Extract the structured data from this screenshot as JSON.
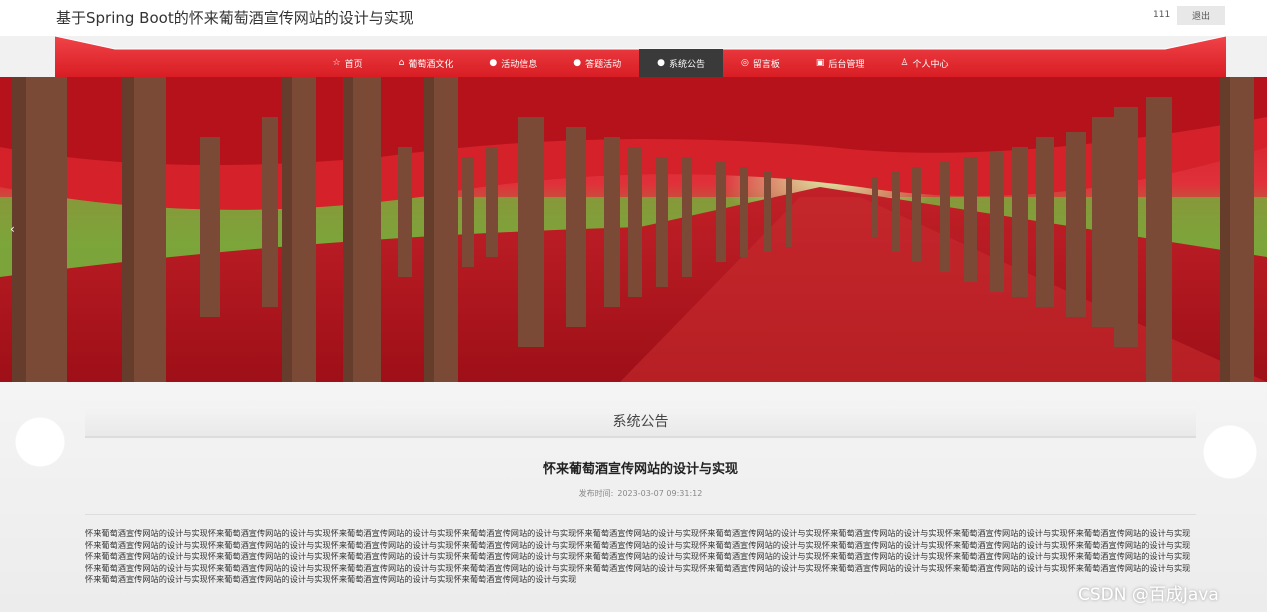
{
  "header": {
    "site_title": "基于Spring Boot的怀来葡萄酒宣传网站的设计与实现",
    "username": "111",
    "logout_label": "退出"
  },
  "nav": {
    "items": [
      {
        "label": "首页",
        "icon": "star-icon",
        "glyph": "☆"
      },
      {
        "label": "葡萄酒文化",
        "icon": "home-icon",
        "glyph": "⌂"
      },
      {
        "label": "活动信息",
        "icon": "info-icon",
        "glyph": "●"
      },
      {
        "label": "答题活动",
        "icon": "info-icon",
        "glyph": "●"
      },
      {
        "label": "系统公告",
        "icon": "info-icon",
        "glyph": "●",
        "active": true
      },
      {
        "label": "留言板",
        "icon": "message-icon",
        "glyph": "◎"
      },
      {
        "label": "后台管理",
        "icon": "admin-icon",
        "glyph": "▣"
      },
      {
        "label": "个人中心",
        "icon": "user-icon",
        "glyph": "♙"
      }
    ],
    "active_color": "#3a3a3a",
    "bar_color": "#e8262b"
  },
  "banner": {
    "description_icon": "red-maple-avenue-image",
    "prev_label": "‹"
  },
  "notice": {
    "section_title": "系统公告",
    "article_title": "怀来葡萄酒宣传网站的设计与实现",
    "publish_label": "发布时间:",
    "publish_time": "2023-03-07 09:31:12",
    "body": "怀来葡萄酒宣传网站的设计与实现怀来葡萄酒宣传网站的设计与实现怀来葡萄酒宣传网站的设计与实现怀来葡萄酒宣传网站的设计与实现怀来葡萄酒宣传网站的设计与实现怀来葡萄酒宣传网站的设计与实现怀来葡萄酒宣传网站的设计与实现怀来葡萄酒宣传网站的设计与实现怀来葡萄酒宣传网站的设计与实现怀来葡萄酒宣传网站的设计与实现怀来葡萄酒宣传网站的设计与实现怀来葡萄酒宣传网站的设计与实现怀来葡萄酒宣传网站的设计与实现怀来葡萄酒宣传网站的设计与实现怀来葡萄酒宣传网站的设计与实现怀来葡萄酒宣传网站的设计与实现怀来葡萄酒宣传网站的设计与实现怀来葡萄酒宣传网站的设计与实现怀来葡萄酒宣传网站的设计与实现怀来葡萄酒宣传网站的设计与实现怀来葡萄酒宣传网站的设计与实现怀来葡萄酒宣传网站的设计与实现怀来葡萄酒宣传网站的设计与实现怀来葡萄酒宣传网站的设计与实现怀来葡萄酒宣传网站的设计与实现怀来葡萄酒宣传网站的设计与实现怀来葡萄酒宣传网站的设计与实现怀来葡萄酒宣传网站的设计与实现怀来葡萄酒宣传网站的设计与实现怀来葡萄酒宣传网站的设计与实现怀来葡萄酒宣传网站的设计与实现怀来葡萄酒宣传网站的设计与实现怀来葡萄酒宣传网站的设计与实现怀来葡萄酒宣传网站的设计与实现怀来葡萄酒宣传网站的设计与实现怀来葡萄酒宣传网站的设计与实现怀来葡萄酒宣传网站的设计与实现怀来葡萄酒宣传网站的设计与实现怀来葡萄酒宣传网站的设计与实现怀来葡萄酒宣传网站的设计与实现"
  },
  "watermark": "CSDN @百成Java"
}
